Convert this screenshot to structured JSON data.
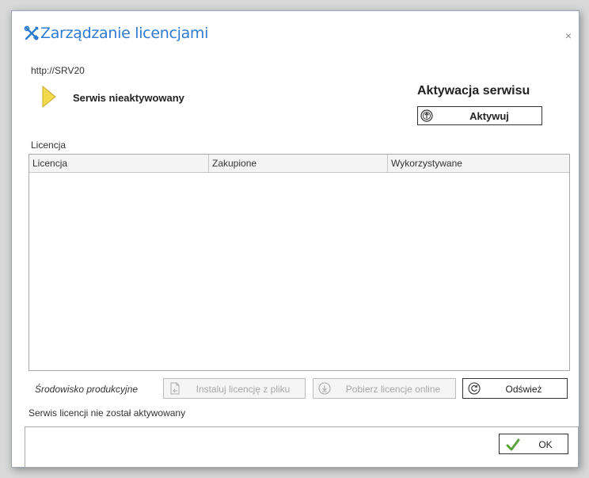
{
  "window": {
    "title": "Zarządzanie licencjami",
    "close_glyph": "×"
  },
  "service": {
    "url": "http://SRV20",
    "status": "Serwis nieaktywowany",
    "status_icon": "triangle-right-icon",
    "status_color": "#f2d94e"
  },
  "activation": {
    "title": "Aktywacja serwisu",
    "button_label": "Aktywuj",
    "button_icon": "arrow-up-circle-icon"
  },
  "licenses": {
    "section_label": "Licencja",
    "columns": [
      "Licencja",
      "Zakupione",
      "Wykorzystywane"
    ],
    "rows": []
  },
  "environment": "Środowisko produkcyjne",
  "actions": {
    "install_label": "Instaluj licencję z pliku",
    "download_label": "Pobierz licencje online",
    "refresh_label": "Odśwież"
  },
  "footer": {
    "status_message": "Serwis licencji nie został aktywowany",
    "ok_label": "OK",
    "ok_icon_color": "#5aa33c"
  },
  "colors": {
    "title": "#2e7bcf",
    "accent": "#2e7bcf"
  }
}
